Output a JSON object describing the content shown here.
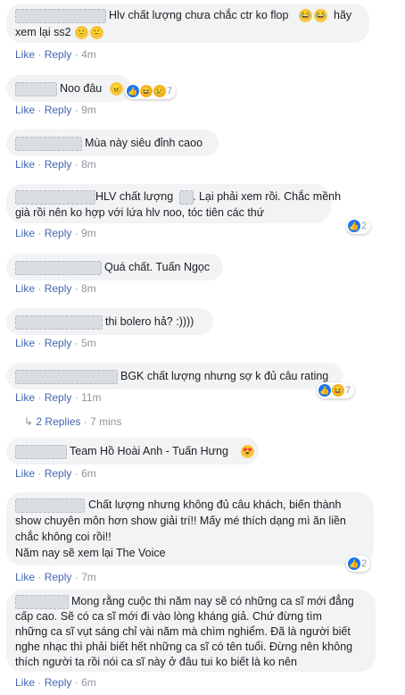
{
  "comments": [
    {
      "text_lines": [
        "Hlv chất lượng chưa chắc ctr ko flop",
        "xem lại ss2"
      ],
      "tail_line1": "hãy",
      "emojis_line1": [
        "😂",
        "😂"
      ],
      "emojis_line2": [
        "🙂",
        "🙂"
      ],
      "like": "Like",
      "reply": "Reply",
      "time": "4m"
    },
    {
      "text_lines": [
        "Noo đâu"
      ],
      "emojis_line1": [
        "😠"
      ],
      "like": "Like",
      "reply": "Reply",
      "time": "9m",
      "reaction_count": "7"
    },
    {
      "text_lines": [
        "Mùa này siêu đỉnh caoo"
      ],
      "like": "Like",
      "reply": "Reply",
      "time": "8m"
    },
    {
      "text_lines": [
        "HLV chất lượng",
        ". Lại phải xem rồi. Chắc mềnh",
        "già rồi nên ko hợp với lứa hlv noo, tóc tiên các thứ"
      ],
      "like": "Like",
      "reply": "Reply",
      "time": "9m",
      "reaction_count": "2"
    },
    {
      "text_lines": [
        "Quá chất. Tuấn Ngọc"
      ],
      "like": "Like",
      "reply": "Reply",
      "time": "8m"
    },
    {
      "text_lines": [
        "thi bolero hả? :))))"
      ],
      "like": "Like",
      "reply": "Reply",
      "time": "5m"
    },
    {
      "text_lines": [
        "BGK chất lượng nhưng sợ k đủ câu rating"
      ],
      "like": "Like",
      "reply": "Reply",
      "time": "11m",
      "reaction_count": "7"
    },
    {
      "text_lines": [
        "Team Hồ Hoài Anh - Tuấn Hưng"
      ],
      "emojis_line1": [
        "😍"
      ],
      "like": "Like",
      "reply": "Reply",
      "time": "6m"
    },
    {
      "text_lines": [
        "Chất lượng nhưng không đủ câu khách, biến thành",
        "show chuyên môn hơn show giải trí!! Mấy mé thích dạng mì ăn liền",
        "chắc không coi rồi!!",
        "Năm nay sẽ xem lại The Voice"
      ],
      "like": "Like",
      "reply": "Reply",
      "time": "7m",
      "reaction_count": "2"
    },
    {
      "text_lines": [
        "Mong rằng cuộc thi năm nay sẽ có những ca sĩ mới đẳng",
        "cấp cao. Sẽ có ca sĩ mới đi vào lòng kháng giả. Chứ đừng tìm",
        "những ca sĩ vụt sáng chỉ vài năm mà chìm nghiểm. Đã là người biết",
        "nghe nhạc thì phải biết hết những ca sĩ có tên tuổi. Đừng nên không",
        "thích người ta rồi nói ca sĩ này ở đâu tui ko biết là ko nên"
      ],
      "like": "Like",
      "reply": "Reply",
      "time": "6m"
    }
  ],
  "replies_link": {
    "label": "2 Replies",
    "time": "7 mins"
  },
  "separator": "·",
  "icons": {
    "reply_arrow": "reply-arrow-icon",
    "like_reaction": "like-reaction-icon",
    "haha_reaction": "haha-reaction-icon",
    "sad_reaction": "sad-reaction-icon"
  },
  "colors": {
    "bubble": "#f2f3f5",
    "link": "#4267b2",
    "meta": "#90949c",
    "like_blue": "#1877f2"
  }
}
